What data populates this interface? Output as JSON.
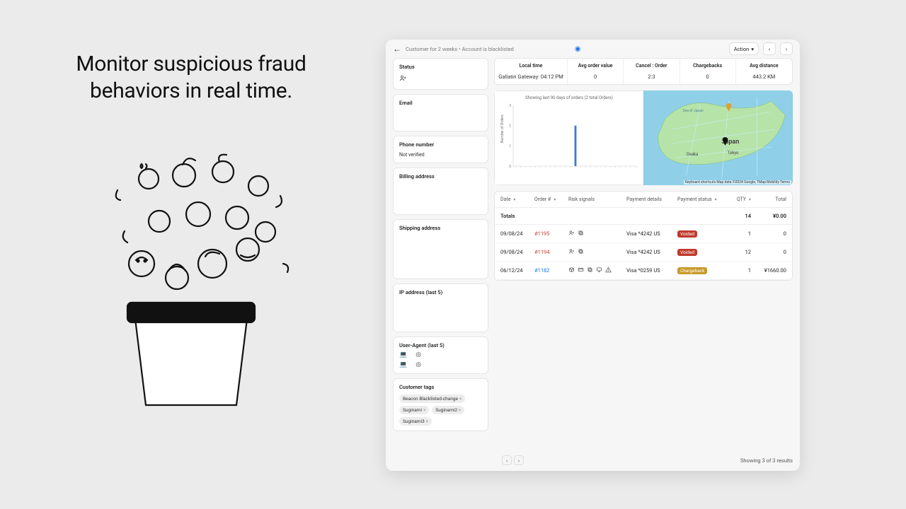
{
  "headline": "Monitor suspicious fraud behaviors in real time.",
  "breadcrumb": {
    "left": "Customer for 2 weeks",
    "right": "Account is blacklisted"
  },
  "action_label": "Action",
  "metrics": [
    {
      "label": "Local time",
      "value": "Gallatin Gateway: 04:12 PM"
    },
    {
      "label": "Avg order value",
      "value": "0"
    },
    {
      "label": "Cancel : Order",
      "value": "2:3"
    },
    {
      "label": "Chargebacks",
      "value": "0"
    },
    {
      "label": "Avg distance",
      "value": "443.2 KM"
    }
  ],
  "sidebar": {
    "status": "Status",
    "email": "Email",
    "phone_h": "Phone number",
    "phone_v": "Not verified",
    "billing": "Billing address",
    "shipping": "Shipping address",
    "ip": "IP address (last 5)",
    "ua": "User-Agent (last 5)",
    "tags_h": "Customer tags"
  },
  "tags": [
    "Beacon Blacklisted-change",
    "Suginami",
    "Suginami2",
    "Suginami3"
  ],
  "chart_data": {
    "type": "bar",
    "caption": "Showing last 90 days of orders (2 total Orders)",
    "ylabel": "Number of Orders",
    "ylim": [
      0,
      3
    ],
    "yticks": [
      0,
      1,
      2,
      3
    ],
    "values": [
      0,
      0,
      0,
      0,
      0,
      0,
      0,
      0,
      0,
      0,
      0,
      0,
      2,
      0,
      0,
      0,
      0,
      0,
      0,
      0,
      0,
      0,
      0,
      0,
      0
    ]
  },
  "map": {
    "attr": "Keyboard shortcuts   Map data ©2024 Google, TMap Mobility   Terms",
    "labels": {
      "japan": "Japan",
      "tokyo": "Tokyo",
      "osaka": "Osaka",
      "sea": "Sea of Japan"
    }
  },
  "table": {
    "headers": [
      "Date",
      "Order #",
      "Risk signals",
      "Payment details",
      "Payment status",
      "QTY",
      "Total"
    ],
    "totals": {
      "label": "Totals",
      "qty": "14",
      "total": "¥0.00"
    },
    "rows": [
      {
        "date": "09/08/24",
        "order": "#1195",
        "order_style": "red",
        "signals": [
          "person",
          "copy"
        ],
        "pay": "Visa *4242 US",
        "status": "Voided",
        "status_kind": "red",
        "qty": "1",
        "total": "0"
      },
      {
        "date": "09/08/24",
        "order": "#1194",
        "order_style": "red",
        "signals": [
          "person",
          "copy"
        ],
        "pay": "Visa *4242 US",
        "status": "Voided",
        "status_kind": "red",
        "qty": "12",
        "total": "0"
      },
      {
        "date": "06/12/24",
        "order": "#1182",
        "order_style": "blue",
        "signals": [
          "box",
          "card",
          "copy",
          "device",
          "warn"
        ],
        "pay": "Visa *0259 US",
        "status": "Chargeback",
        "status_kind": "amber",
        "qty": "1",
        "total": "¥1660.00"
      }
    ]
  },
  "footer": "Showing 3 of 3 results"
}
